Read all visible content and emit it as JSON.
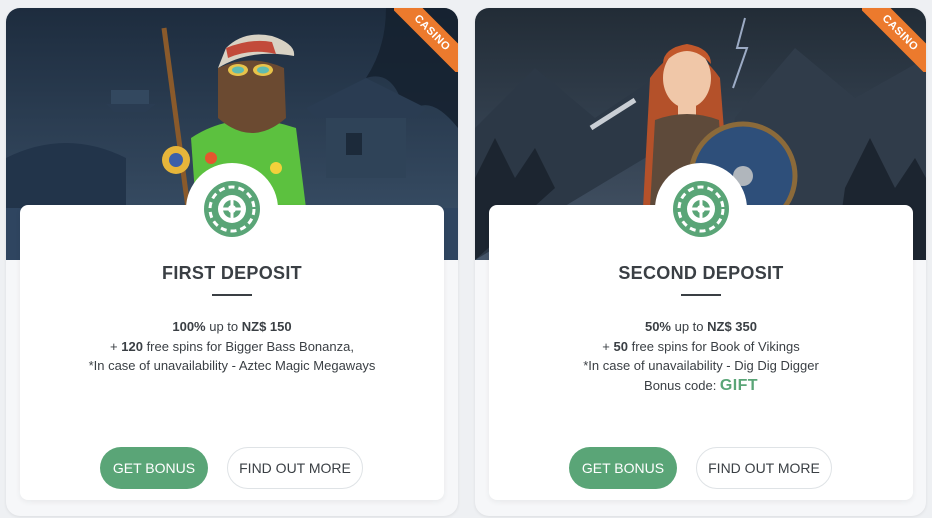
{
  "colors": {
    "accent": "#5aa577",
    "ribbon": "#ec7a2d",
    "text": "#3a3f44"
  },
  "cards": [
    {
      "ribbon": "CASINO",
      "icon": "roulette-icon",
      "title": "FIRST DEPOSIT",
      "line1_bold_pct": "100%",
      "line1_mid": " up to ",
      "line1_bold_amt": "NZ$ 150",
      "line2_prefix": "+ ",
      "line2_bold": "120",
      "line2_rest": " free spins for Bigger Bass Bonanza,",
      "line3": "*In case of unavailability - Aztec Magic Megaways",
      "primary_label": "GET BONUS",
      "secondary_label": "FIND OUT MORE"
    },
    {
      "ribbon": "CASINO",
      "icon": "roulette-icon",
      "title": "SECOND DEPOSIT",
      "line1_bold_pct": "50%",
      "line1_mid": " up to ",
      "line1_bold_amt": "NZ$ 350",
      "line2_prefix": "+ ",
      "line2_bold": "50",
      "line2_rest": " free spins for Book of Vikings",
      "line3": "*In case of unavailability - Dig Dig Digger",
      "code_label": "Bonus code: ",
      "code_value": "GIFT",
      "primary_label": "GET BONUS",
      "secondary_label": "FIND OUT MORE"
    }
  ]
}
